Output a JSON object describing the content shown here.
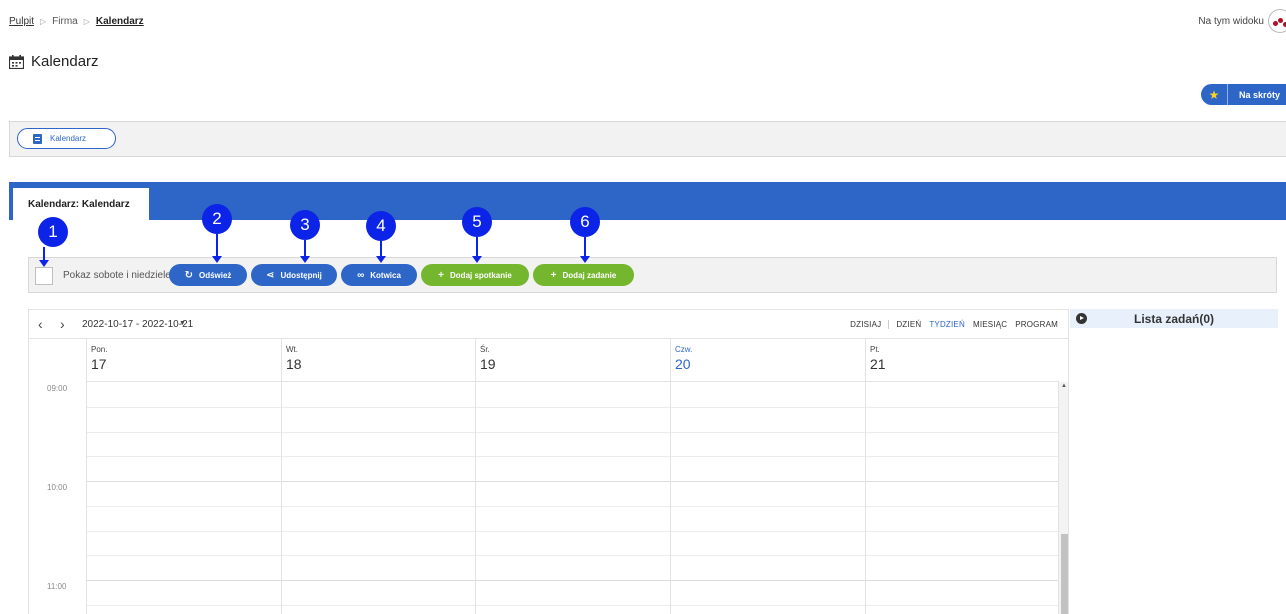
{
  "breadcrumb": {
    "items": [
      "Pulpit",
      "Firma",
      "Kalendarz"
    ]
  },
  "header": {
    "view_label": "Na tym widoku",
    "title": "Kalendarz",
    "shortcut_label": "Na skróty"
  },
  "module_bar": {
    "pill_label": "Kalendarz"
  },
  "tab": {
    "label": "Kalendarz: Kalendarz"
  },
  "toolbar": {
    "weekend_label": "Pokaz sobote i niedziele",
    "buttons": [
      "Odśwież",
      "Udostępnij",
      "Kotwica",
      "Dodaj spotkanie",
      "Dodaj zadanie"
    ]
  },
  "markers": [
    "1",
    "2",
    "3",
    "4",
    "5",
    "6"
  ],
  "calendar": {
    "range": "2022-10-17 - 2022-10-21",
    "views": [
      "DZISIAJ",
      "DZIEŃ",
      "TYDZIEŃ",
      "MIESIĄC",
      "PROGRAM"
    ],
    "active_view": "TYDZIEŃ",
    "days": [
      {
        "name": "Pon.",
        "num": "17"
      },
      {
        "name": "Wt.",
        "num": "18"
      },
      {
        "name": "Śr.",
        "num": "19"
      },
      {
        "name": "Czw.",
        "num": "20"
      },
      {
        "name": "Pt.",
        "num": "21"
      }
    ],
    "today_index": 3,
    "times": [
      "09:00",
      "10:00",
      "11:00"
    ]
  },
  "tasks": {
    "title": "Lista zadań(0)"
  },
  "colors": {
    "primary": "#2e66c8",
    "green": "#74b62e",
    "marker": "#0b24e8"
  }
}
